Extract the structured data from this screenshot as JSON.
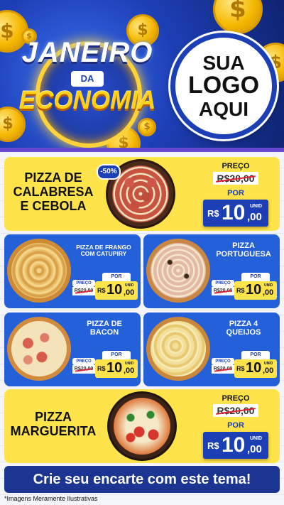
{
  "header": {
    "title_line1": "JANEIRO",
    "title_line2": "DA",
    "title_line3": "ECONOMIA",
    "logo_line1": "SUA",
    "logo_line2": "LOGO",
    "logo_line3": "AQUI",
    "coin_symbol": "$"
  },
  "colors": {
    "brand_blue": "#1d3fb6",
    "card_yellow": "#ffe34a",
    "card_blue": "#2460d8",
    "gold": "#ffd21a"
  },
  "products": {
    "calabresa": {
      "name_l1": "PIZZA DE",
      "name_l2": "CALABRESA",
      "name_l3": "E CEBOLA",
      "discount": "-50%",
      "price_label": "PREÇO",
      "old_price": "R$20,00",
      "por_label": "POR",
      "currency": "R$",
      "price_int": "10",
      "price_cents": ",00",
      "unit": "UNID"
    },
    "frango": {
      "name_l1": "PIZZA DE FRANGO",
      "name_l2": "COM CATUPIRY",
      "price_label": "PREÇO",
      "old_price": "R$20,00",
      "por_label": "POR",
      "currency": "R$",
      "price_int": "10",
      "price_cents": ",00",
      "unit": "UNID"
    },
    "portuguesa": {
      "name_l1": "PIZZA",
      "name_l2": "PORTUGUESA",
      "price_label": "PREÇO",
      "old_price": "R$20,00",
      "por_label": "POR",
      "currency": "R$",
      "price_int": "10",
      "price_cents": ",00",
      "unit": "UNID"
    },
    "bacon": {
      "name_l1": "PIZZA DE",
      "name_l2": "BACON",
      "price_label": "PREÇO",
      "old_price": "R$20,00",
      "por_label": "POR",
      "currency": "R$",
      "price_int": "10",
      "price_cents": ",00",
      "unit": "UNID"
    },
    "queijos": {
      "name_l1": "PIZZA 4",
      "name_l2": "QUEIJOS",
      "price_label": "PREÇO",
      "old_price": "R$20,00",
      "por_label": "POR",
      "currency": "R$",
      "price_int": "10",
      "price_cents": ",00",
      "unit": "UNID"
    },
    "marguerita": {
      "name_l1": "PIZZA",
      "name_l2": "MARGUERITA",
      "price_label": "PREÇO",
      "old_price": "R$20,00",
      "por_label": "POR",
      "currency": "R$",
      "price_int": "10",
      "price_cents": ",00",
      "unit": "UNID"
    }
  },
  "footer": {
    "cta": "Crie seu encarte com este tema!",
    "disclaimer": "*Imagens Meramente Ilustrativas"
  }
}
